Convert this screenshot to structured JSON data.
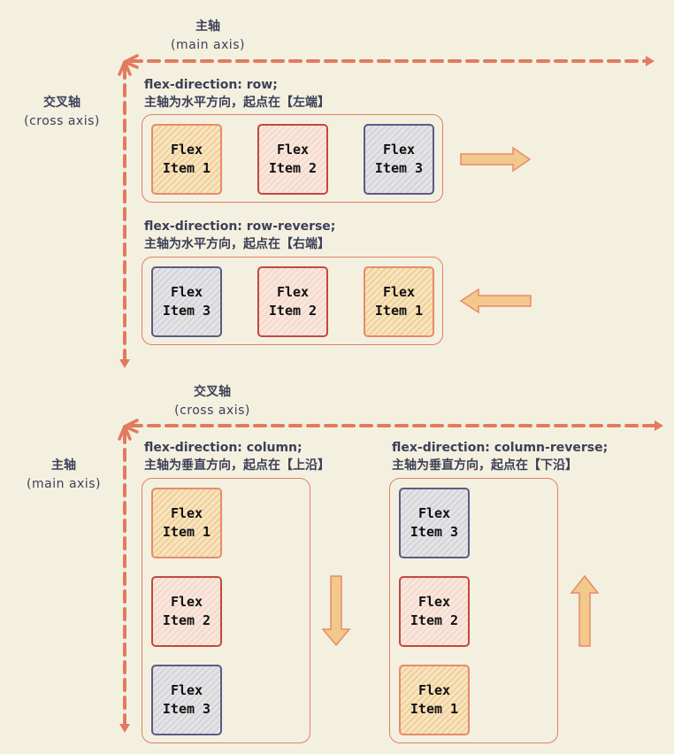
{
  "colors": {
    "background": "#f4f0e0",
    "axis": "#e27a5f",
    "container_border": "#e07f67",
    "arrow_fill": "#f2c98a",
    "arrow_stroke": "#e8896a",
    "item1": "#f2cf96",
    "item2": "#f6d8cc",
    "item3": "#d4d3de"
  },
  "top_section": {
    "main_axis_label": {
      "zh": "主轴",
      "en": "(main axis)"
    },
    "cross_axis_label": {
      "zh": "交叉轴",
      "en": "(cross axis)"
    },
    "row": {
      "code": "flex-direction: row;",
      "desc": "主轴为水平方向，起点在【左端】",
      "items": [
        {
          "line1": "Flex",
          "line2": "Item 1"
        },
        {
          "line1": "Flex",
          "line2": "Item 2"
        },
        {
          "line1": "Flex",
          "line2": "Item 3"
        }
      ],
      "arrow": "right-arrow"
    },
    "row_reverse": {
      "code": "flex-direction: row-reverse;",
      "desc": "主轴为水平方向，起点在【右端】",
      "items": [
        {
          "line1": "Flex",
          "line2": "Item 3"
        },
        {
          "line1": "Flex",
          "line2": "Item 2"
        },
        {
          "line1": "Flex",
          "line2": "Item 1"
        }
      ],
      "arrow": "left-arrow"
    }
  },
  "bottom_section": {
    "cross_axis_label": {
      "zh": "交叉轴",
      "en": "(cross axis)"
    },
    "main_axis_label": {
      "zh": "主轴",
      "en": "(main axis)"
    },
    "column": {
      "code": "flex-direction: column;",
      "desc": "主轴为垂直方向，起点在【上沿】",
      "items": [
        {
          "line1": "Flex",
          "line2": "Item 1"
        },
        {
          "line1": "Flex",
          "line2": "Item 2"
        },
        {
          "line1": "Flex",
          "line2": "Item 3"
        }
      ],
      "arrow": "down-arrow"
    },
    "column_reverse": {
      "code": "flex-direction: column-reverse;",
      "desc": "主轴为垂直方向，起点在【下沿】",
      "items": [
        {
          "line1": "Flex",
          "line2": "Item 3"
        },
        {
          "line1": "Flex",
          "line2": "Item 2"
        },
        {
          "line1": "Flex",
          "line2": "Item 1"
        }
      ],
      "arrow": "up-arrow"
    }
  }
}
